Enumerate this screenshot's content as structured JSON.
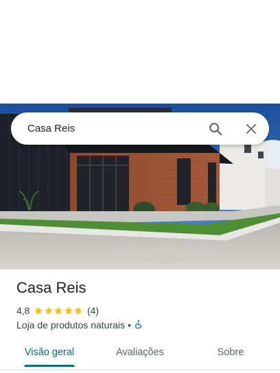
{
  "search": {
    "query": "Casa Reis",
    "search_icon": "search-icon",
    "close_icon": "close-icon"
  },
  "place": {
    "name": "Casa Reis",
    "rating": "4,8",
    "rating_value": 4.8,
    "stars": 5,
    "review_count": "(4)",
    "category": "Loja de produtos naturais",
    "separator": "•",
    "accessibility_icon": "wheelchair-icon"
  },
  "tabs": [
    {
      "label": "Visão geral",
      "active": true
    },
    {
      "label": "Avaliações",
      "active": false
    },
    {
      "label": "Sobre",
      "active": false
    }
  ],
  "colors": {
    "accent": "#0b6e7a",
    "star": "#fbbc04",
    "accessibility": "#1a73e8",
    "text_primary": "#202124",
    "text_secondary": "#3c4043"
  }
}
